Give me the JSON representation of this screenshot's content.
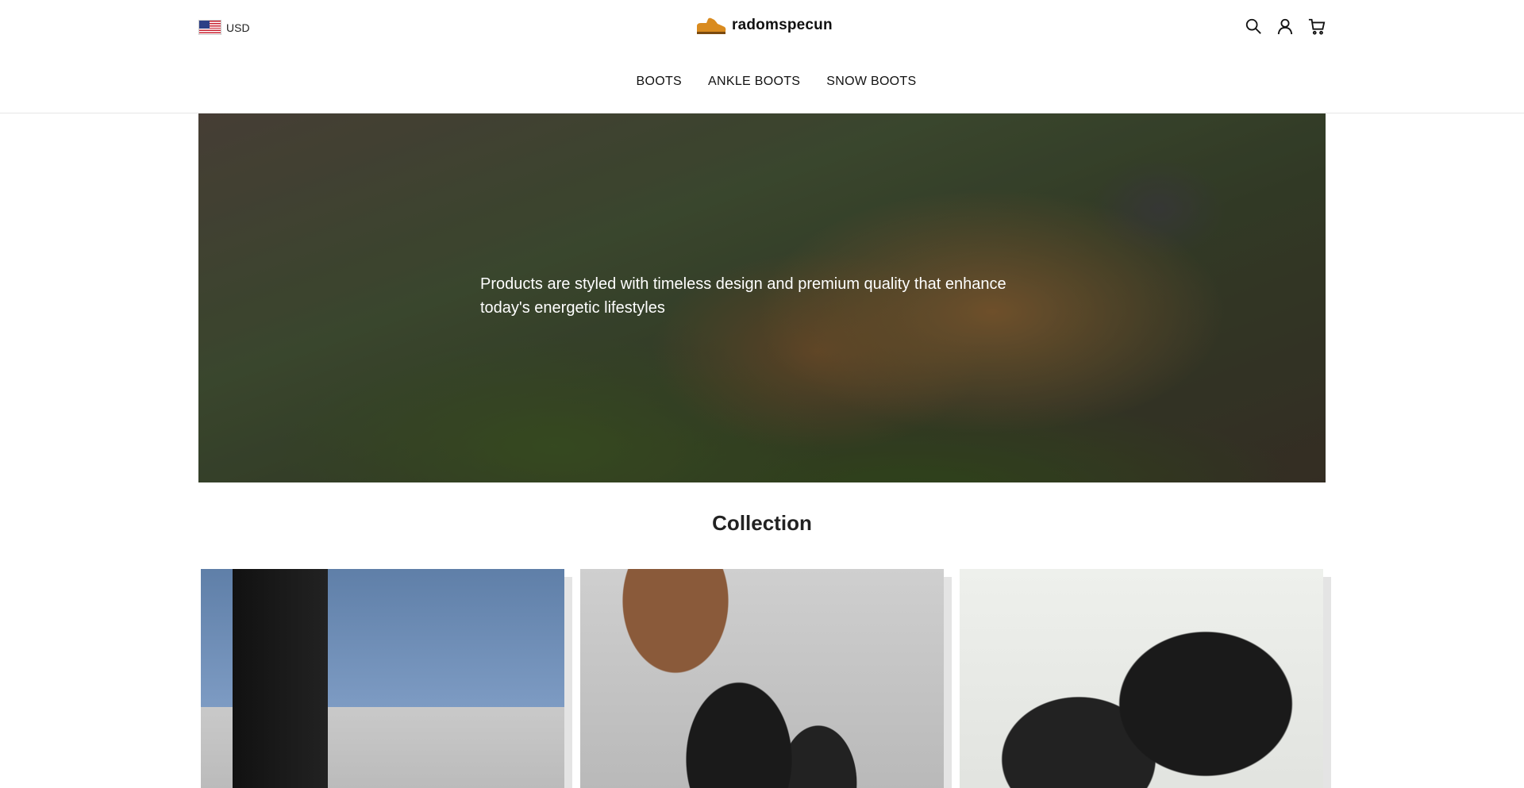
{
  "header": {
    "currency": {
      "label": "USD",
      "flag": "us-flag-icon"
    },
    "logo": {
      "text": "radomspecun",
      "icon": "boot-icon",
      "color": "#d98b1f"
    },
    "icons": [
      "search-icon",
      "account-icon",
      "cart-icon"
    ]
  },
  "nav": {
    "items": [
      {
        "label": "BOOTS"
      },
      {
        "label": "ANKLE BOOTS"
      },
      {
        "label": "SNOW BOOTS"
      }
    ]
  },
  "hero": {
    "text": "Products are styled with timeless design and premium quality that enhance today's energetic lifestyles"
  },
  "collection": {
    "title": "Collection",
    "cards": [
      {
        "image": "black-lace-up-ankle-boots-photo"
      },
      {
        "image": "black-slouch-ankle-boots-photo"
      },
      {
        "image": "black-suede-zip-boots-photo"
      }
    ]
  }
}
